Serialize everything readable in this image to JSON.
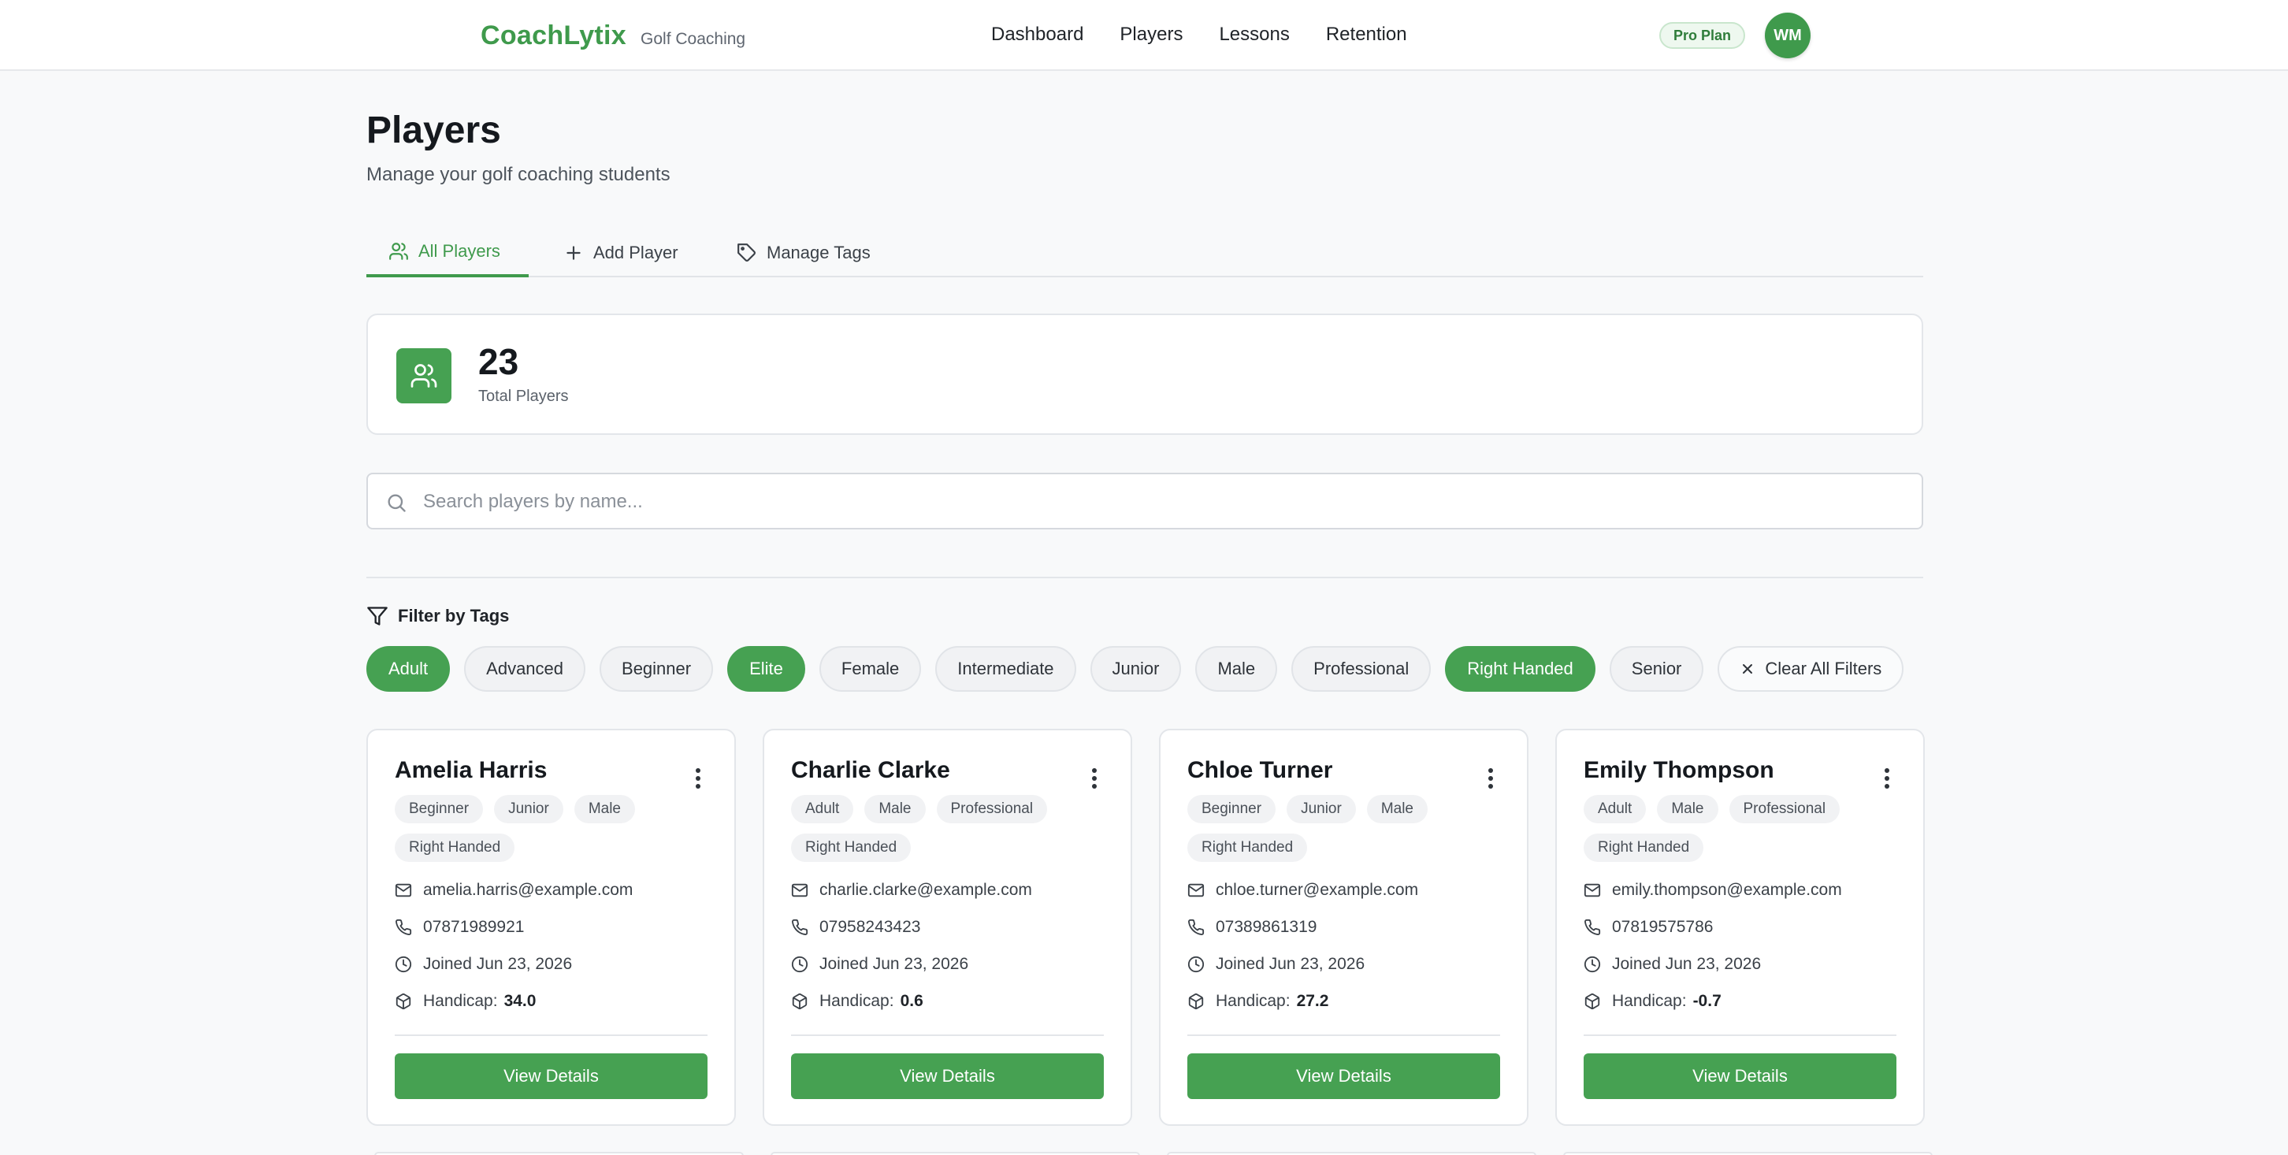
{
  "header": {
    "brand": "CoachLytix",
    "brand_sub": "Golf Coaching",
    "nav": [
      "Dashboard",
      "Players",
      "Lessons",
      "Retention"
    ],
    "plan": "Pro Plan",
    "avatar_initials": "WM"
  },
  "page": {
    "title": "Players",
    "subtitle": "Manage your golf coaching students"
  },
  "tabs": [
    {
      "label": "All Players",
      "active": true
    },
    {
      "label": "Add Player",
      "active": false
    },
    {
      "label": "Manage Tags",
      "active": false
    }
  ],
  "stats": {
    "count": "23",
    "label": "Total Players"
  },
  "search": {
    "placeholder": "Search players by name..."
  },
  "filter": {
    "title": "Filter by Tags",
    "tags": [
      {
        "label": "Adult",
        "selected": true
      },
      {
        "label": "Advanced",
        "selected": false
      },
      {
        "label": "Beginner",
        "selected": false
      },
      {
        "label": "Elite",
        "selected": true
      },
      {
        "label": "Female",
        "selected": false
      },
      {
        "label": "Intermediate",
        "selected": false
      },
      {
        "label": "Junior",
        "selected": false
      },
      {
        "label": "Male",
        "selected": false
      },
      {
        "label": "Professional",
        "selected": false
      },
      {
        "label": "Right Handed",
        "selected": true
      },
      {
        "label": "Senior",
        "selected": false
      }
    ],
    "clear_label": "Clear All Filters"
  },
  "players": [
    {
      "name": "Amelia Harris",
      "tags_row1": [
        "Beginner",
        "Junior",
        "Male"
      ],
      "tags_row2": [
        "Right Handed"
      ],
      "email": "amelia.harris@example.com",
      "phone": "07871989921",
      "joined": "Joined Jun 23, 2026",
      "handicap_label": "Handicap:",
      "handicap": "34.0",
      "button": "View Details"
    },
    {
      "name": "Charlie Clarke",
      "tags_row1": [
        "Adult",
        "Male",
        "Professional"
      ],
      "tags_row2": [
        "Right Handed"
      ],
      "email": "charlie.clarke@example.com",
      "phone": "07958243423",
      "joined": "Joined Jun 23, 2026",
      "handicap_label": "Handicap:",
      "handicap": "0.6",
      "button": "View Details"
    },
    {
      "name": "Chloe Turner",
      "tags_row1": [
        "Beginner",
        "Junior",
        "Male"
      ],
      "tags_row2": [
        "Right Handed"
      ],
      "email": "chloe.turner@example.com",
      "phone": "07389861319",
      "joined": "Joined Jun 23, 2026",
      "handicap_label": "Handicap:",
      "handicap": "27.2",
      "button": "View Details"
    },
    {
      "name": "Emily Thompson",
      "tags_row1": [
        "Adult",
        "Male",
        "Professional"
      ],
      "tags_row2": [
        "Right Handed"
      ],
      "email": "emily.thompson@example.com",
      "phone": "07819575786",
      "joined": "Joined Jun 23, 2026",
      "handicap_label": "Handicap:",
      "handicap": "-0.7",
      "button": "View Details"
    }
  ],
  "colors": {
    "accent": "#46a152",
    "brand": "#3f9a4c"
  },
  "icons": [
    "users-icon",
    "plus-icon",
    "tag-icon",
    "search-icon",
    "filter-icon",
    "close-icon",
    "mail-icon",
    "phone-icon",
    "clock-icon",
    "cube-icon",
    "more-vertical-icon"
  ]
}
